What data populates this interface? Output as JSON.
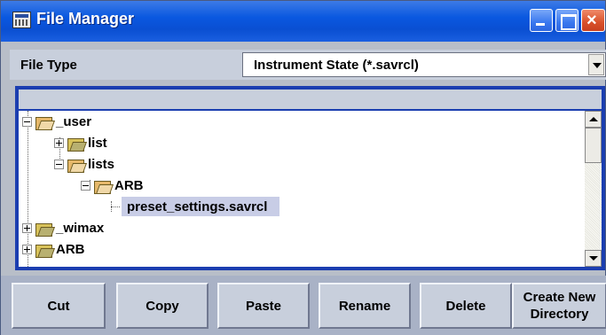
{
  "window": {
    "title": "File Manager"
  },
  "file_type": {
    "label": "File Type",
    "selected": "Instrument State (*.savrcl)"
  },
  "tree": {
    "nodes": [
      {
        "label": "_user",
        "expander": "minus",
        "folder": "open"
      },
      {
        "label": "list",
        "expander": "plus",
        "folder": "closed"
      },
      {
        "label": "lists",
        "expander": "minus",
        "folder": "open"
      },
      {
        "label": "ARB",
        "expander": "minus",
        "folder": "open"
      },
      {
        "label": "preset_settings.savrcl",
        "selected": true
      },
      {
        "label": "_wimax",
        "expander": "plus",
        "folder": "closed"
      },
      {
        "label": "ARB",
        "expander": "plus",
        "folder": "closed"
      }
    ]
  },
  "actions": {
    "cut": "Cut",
    "copy": "Copy",
    "paste": "Paste",
    "rename": "Rename",
    "delete": "Delete",
    "create_dir_line1": "Create New",
    "create_dir_line2": "Directory"
  }
}
